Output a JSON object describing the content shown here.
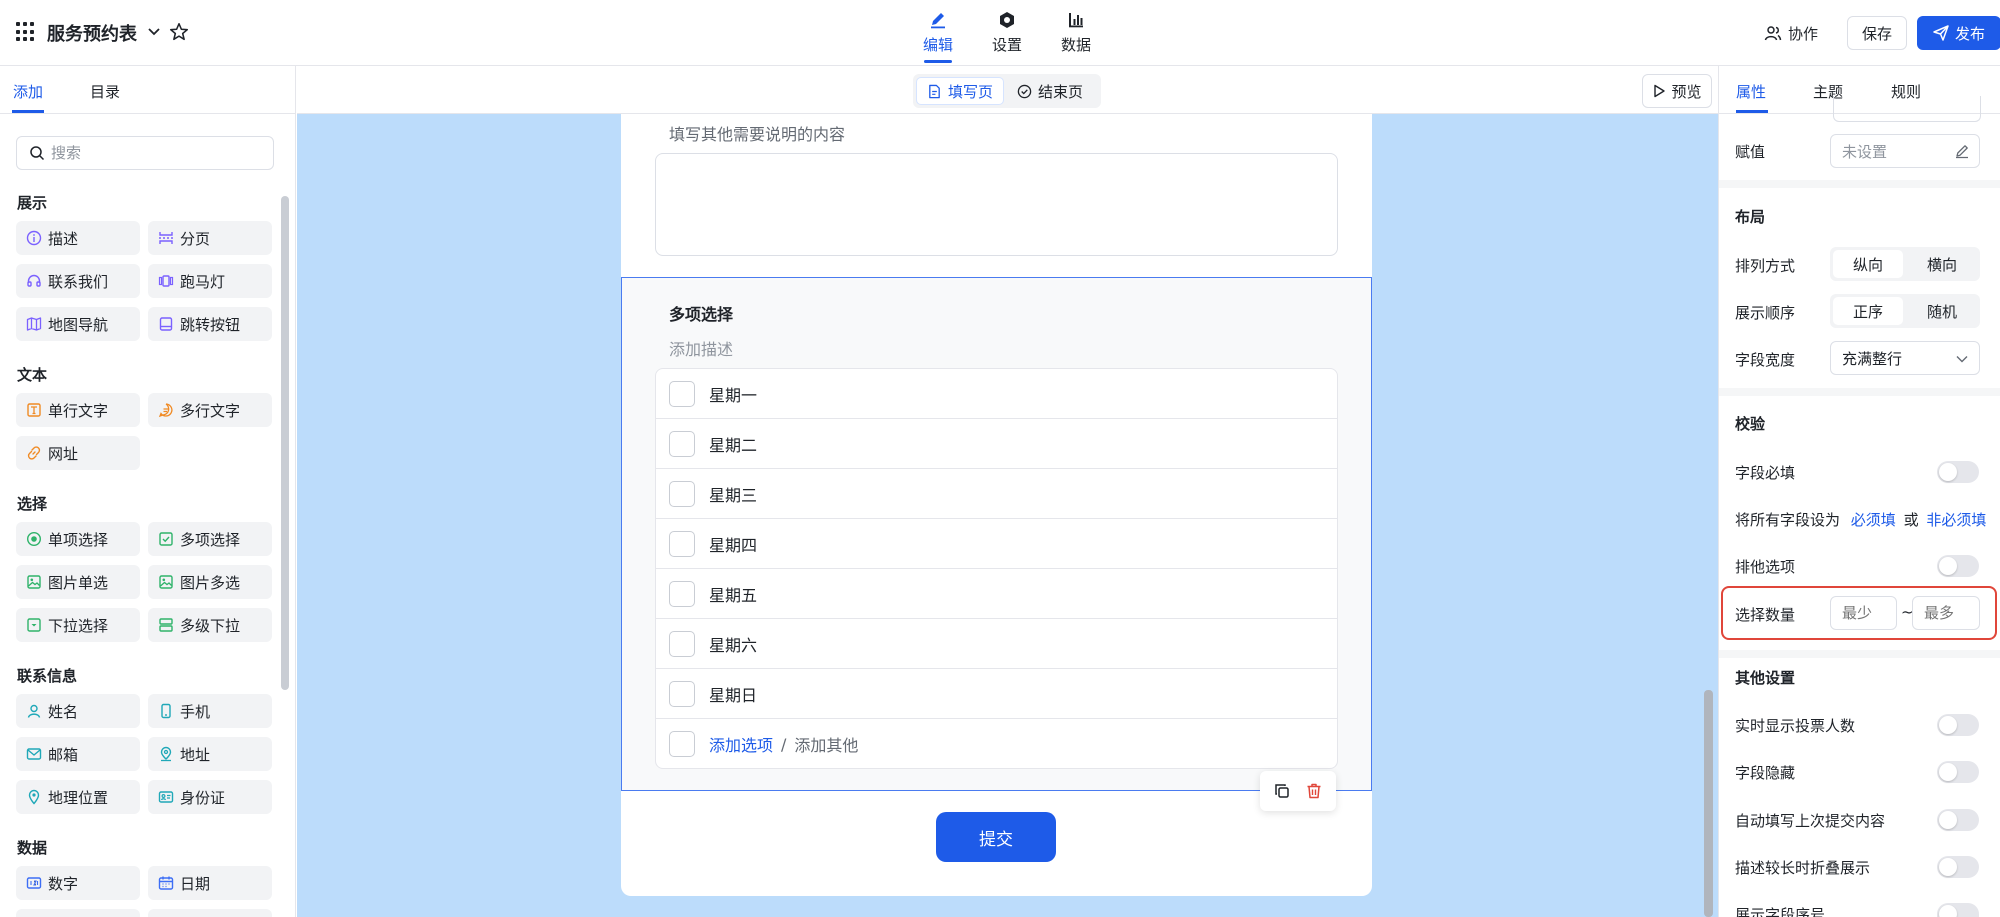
{
  "header": {
    "app_title": "服务预约表",
    "nav_tabs": [
      {
        "label": "编辑",
        "icon": "pen-icon"
      },
      {
        "label": "设置",
        "icon": "hexagon-gear-icon"
      },
      {
        "label": "数据",
        "icon": "bar-chart-icon"
      }
    ],
    "collab_label": "协作",
    "save_label": "保存",
    "publish_label": "发布"
  },
  "left_panel": {
    "tabs": [
      "添加",
      "目录"
    ],
    "search_placeholder": "搜索",
    "groups": [
      {
        "title": "展示",
        "items": [
          "描述",
          "分页",
          "联系我们",
          "跑马灯",
          "地图导航",
          "跳转按钮"
        ]
      },
      {
        "title": "文本",
        "items": [
          "单行文字",
          "多行文字",
          "网址"
        ]
      },
      {
        "title": "选择",
        "items": [
          "单项选择",
          "多项选择",
          "图片单选",
          "图片多选",
          "下拉选择",
          "多级下拉"
        ]
      },
      {
        "title": "联系信息",
        "items": [
          "姓名",
          "手机",
          "邮箱",
          "地址",
          "地理位置",
          "身份证"
        ]
      },
      {
        "title": "数据",
        "items": [
          "数字",
          "日期"
        ]
      }
    ]
  },
  "canvas": {
    "page_switch": [
      "填写页",
      "结束页"
    ],
    "preview_label": "预览",
    "other_hint": "填写其他需要说明的内容",
    "question": {
      "title": "多项选择",
      "desc_placeholder": "添加描述",
      "options": [
        "星期一",
        "星期二",
        "星期三",
        "星期四",
        "星期五",
        "星期六",
        "星期日"
      ],
      "add_option": "添加选项",
      "separator": "/",
      "add_other": "添加其他"
    },
    "submit_label": "提交"
  },
  "right_panel": {
    "tabs": [
      "属性",
      "主题",
      "规则"
    ],
    "assign_label": "赋值",
    "assign_value": "未设置",
    "layout": {
      "title": "布局",
      "arrange_label": "排列方式",
      "arrange_options": [
        "纵向",
        "横向"
      ],
      "order_label": "展示顺序",
      "order_options": [
        "正序",
        "随机"
      ],
      "width_label": "字段宽度",
      "width_value": "充满整行"
    },
    "validation": {
      "title": "校验",
      "required_label": "字段必填",
      "set_all_prefix": "将所有字段设为",
      "set_required": "必须填",
      "or": "或",
      "set_optional": "非必须填",
      "exclusive_label": "排他选项",
      "count_label": "选择数量",
      "min_placeholder": "最少",
      "tilde": "~",
      "max_placeholder": "最多"
    },
    "other": {
      "title": "其他设置",
      "items": [
        "实时显示投票人数",
        "字段隐藏",
        "自动填写上次提交内容",
        "描述较长时折叠展示",
        "展示字段序号"
      ]
    }
  },
  "colors": {
    "accent": "#1e5be8",
    "canvas_bg": "#bcdcfb",
    "highlight": "#e0463a"
  }
}
